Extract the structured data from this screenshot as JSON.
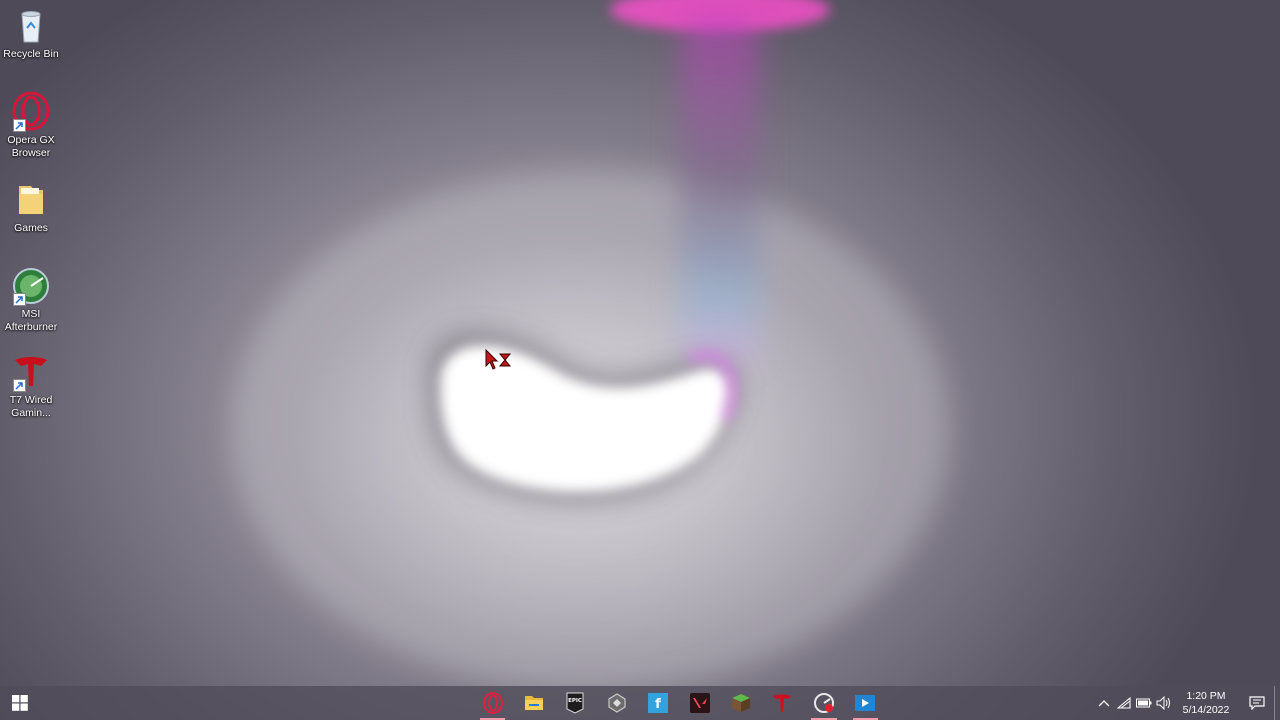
{
  "desktop": {
    "icons": [
      {
        "label": "Recycle Bin",
        "icon": "recycle-bin-icon"
      },
      {
        "label": "Opera GX Browser",
        "icon": "opera-gx-icon"
      },
      {
        "label": "Games",
        "icon": "folder-icon"
      },
      {
        "label": "MSI Afterburner",
        "icon": "msi-afterburner-icon"
      },
      {
        "label": "T7 Wired Gamin...",
        "icon": "t7-gaming-icon"
      }
    ]
  },
  "taskbar": {
    "start_icon": "windows-start-icon",
    "apps": [
      {
        "name": "opera-gx-icon",
        "active": true
      },
      {
        "name": "file-explorer-icon",
        "active": false
      },
      {
        "name": "epic-games-icon",
        "active": false
      },
      {
        "name": "app-launcher-icon",
        "active": false
      },
      {
        "name": "f-app-icon",
        "active": false
      },
      {
        "name": "valorant-icon",
        "active": false
      },
      {
        "name": "minecraft-icon",
        "active": false
      },
      {
        "name": "t7-gaming-icon",
        "active": false
      },
      {
        "name": "msi-afterburner-icon",
        "active": true
      },
      {
        "name": "media-player-icon",
        "active": true
      }
    ],
    "tray": {
      "time": "1:20 PM",
      "date": "5/14/2022"
    }
  },
  "colors": {
    "accent_pink": "#f19aa8",
    "opera_red": "#d9143a"
  }
}
